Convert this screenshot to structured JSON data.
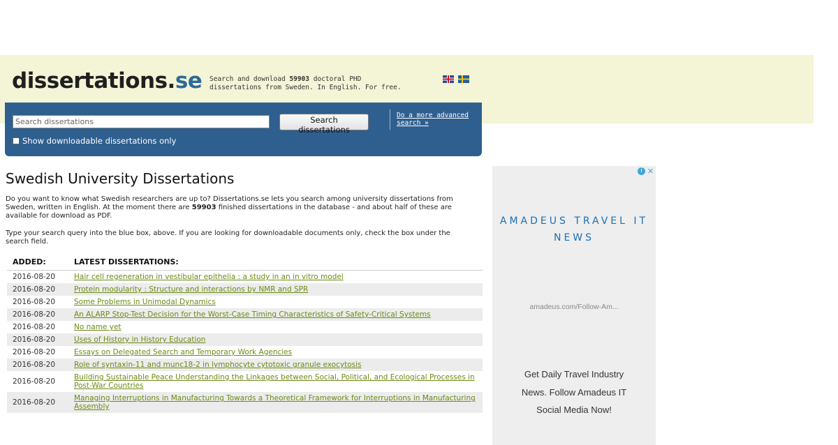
{
  "header": {
    "logo_main": "dissertations.",
    "logo_tld": "se",
    "tagline_pre": "Search and download ",
    "tagline_count": "59903",
    "tagline_post": " doctoral PHD dissertations from Sweden. In English. For free."
  },
  "search": {
    "placeholder": "Search dissertations",
    "button_label": "Search dissertations",
    "advanced_label": "Do a more advanced search »",
    "checkbox_label": "Show downloadable dissertations only"
  },
  "main": {
    "title": "Swedish University Dissertations",
    "intro1_pre": "Do you want to know what Swedish researchers are up to? Dissertations.se lets you search among university dissertations from Sweden, written in English. At the moment there are ",
    "intro1_count": "59903",
    "intro1_post": " finished dissertations in the database - and about half of these are available for download as PDF.",
    "intro2": "Type your search query into the blue box, above. If you are looking for downloadable documents only, check the box under the search field."
  },
  "table": {
    "col_added": "ADDED:",
    "col_latest": "LATEST DISSERTATIONS:",
    "rows": [
      {
        "date": "2016-08-20",
        "title": "Hair cell regeneration in vestibular epithelia : a study in an in vitro model"
      },
      {
        "date": "2016-08-20",
        "title": "Protein modularity : Structure and interactions by NMR and SPR"
      },
      {
        "date": "2016-08-20",
        "title": "Some Problems in Unimodal Dynamics"
      },
      {
        "date": "2016-08-20",
        "title": "An ALARP Stop-Test Decision for the Worst-Case Timing Characteristics of Safety-Critical Systems"
      },
      {
        "date": "2016-08-20",
        "title": "No name yet"
      },
      {
        "date": "2016-08-20",
        "title": "Uses of History in History Education"
      },
      {
        "date": "2016-08-20",
        "title": "Essays on Delegated Search and Temporary Work Agencies"
      },
      {
        "date": "2016-08-20",
        "title": "Role of syntaxin-11 and munc18-2 in lymphocyte cytotoxic granule exocytosis"
      },
      {
        "date": "2016-08-20",
        "title": "Building Sustainable Peace Understanding the Linkages between Social, Political, and Ecological Processes in Post-War Countries"
      },
      {
        "date": "2016-08-20",
        "title": "Managing Interruptions in Manufacturing Towards a Theoretical Framework for Interruptions in Manufacturing Assembly"
      }
    ]
  },
  "ad": {
    "info_icon": "i",
    "close_icon": "✕",
    "headline": "AMADEUS TRAVEL IT NEWS",
    "url": "amadeus.com/Follow-Am...",
    "body": "Get Daily Travel Industry News. Follow Amadeus IT Social Media Now!"
  },
  "colors": {
    "header_bg": "#f4f4d6",
    "search_bg": "#2f5f8f",
    "link": "#6b8a14",
    "ad_headline": "#1a6fb5"
  }
}
